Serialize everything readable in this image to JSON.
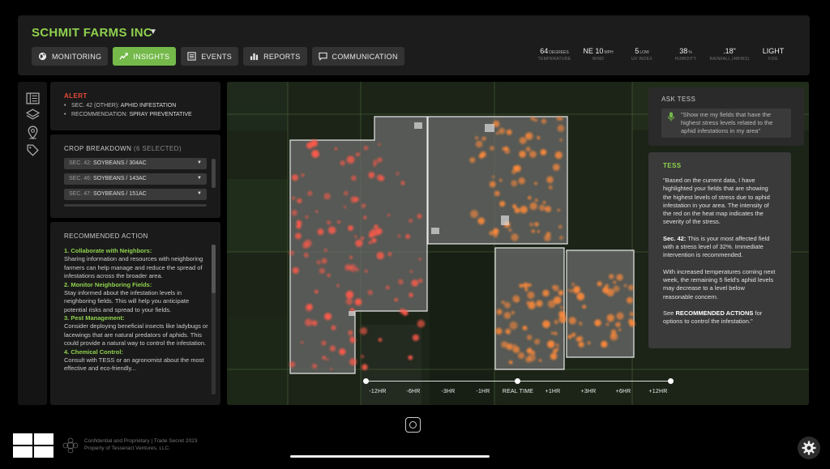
{
  "header": {
    "farm_name": "SCHMIT FARMS INC",
    "tabs": [
      {
        "label": "MONITORING",
        "icon": "globe-icon",
        "active": false
      },
      {
        "label": "INSIGHTS",
        "icon": "trend-icon",
        "active": true
      },
      {
        "label": "EVENTS",
        "icon": "list-icon",
        "active": false
      },
      {
        "label": "REPORTS",
        "icon": "bar-chart-icon",
        "active": false
      },
      {
        "label": "COMMUNICATION",
        "icon": "chat-icon",
        "active": false
      }
    ],
    "weather": [
      {
        "value": "64",
        "unit": "DEGREES",
        "label": "TEMPERATURE"
      },
      {
        "value": "NE 10",
        "unit": "MPH",
        "label": "WIND"
      },
      {
        "value": "5",
        "unit": "LOW",
        "label": "UV INDEX"
      },
      {
        "value": "38",
        "unit": "%",
        "label": "HUMIDITY"
      },
      {
        "value": ".18\"",
        "unit": "",
        "label": "RAINFALL (48HRS)"
      },
      {
        "value": "LIGHT",
        "unit": "",
        "label": "FOG"
      }
    ]
  },
  "alert": {
    "title": "ALERT",
    "line1_label": "SEC. 42 (OTHER): ",
    "line1_value": "APHID INFESTATION",
    "line2_label": "RECOMMENDATION: ",
    "line2_value": "SPRAY PREVENTATIVE"
  },
  "crop_breakdown": {
    "title": "CROP BREAKDOWN",
    "selected": "(6 SELECTED)",
    "rows": [
      {
        "sec": "SEC. 42:",
        "crop": "SOYBEANS / 304AC"
      },
      {
        "sec": "SEC. 46:",
        "crop": "SOYBEANS / 143AC"
      },
      {
        "sec": "SEC. 47:",
        "crop": "SOYBEANS / 151AC"
      }
    ]
  },
  "recommended": {
    "title": "RECOMMENDED ACTION",
    "items": [
      {
        "head": "1. Collaborate with Neighbors:",
        "body": "Sharing information and resources with neighboring farmers can help manage and reduce the spread of infestations across the broader area."
      },
      {
        "head": "2. Monitor Neighboring Fields:",
        "body": "Stay informed about the infestation levels in neighboring fields. This will help you anticipate potential risks and spread to your fields."
      },
      {
        "head": "3. Pest Management:",
        "body": "Consider deploying beneficial insects like ladybugs or lacewings that are natural predators of aphids. This could provide a natural way to control the infestation."
      },
      {
        "head": "4. Chemical Control:",
        "body": "Consult with TESS or an agronomist about the most effective and eco-friendly..."
      }
    ]
  },
  "ask_tess": {
    "title": "ASK TESS",
    "query": "\"Show me my fields that have the highest stress levels related to the aphid infestations in my area\""
  },
  "tess": {
    "title": "TESS",
    "p1": "\"Based on the current data, I have highlighted your fields that are showing the highest levels of stress due to aphid infestation in your area. The intensity of the red on the heat map indicates the severity of the stress.",
    "p2_bold": "Sec. 42:",
    "p2": " This is your most affected field with a stress level of 32%. Immediate intervention is recommended.",
    "p3": "With increased temperatures coming next week, the remaining 5 field's aphid levels may decrease to a level below reasonable concern.",
    "p4_pre": "See ",
    "p4_bold": "RECOMMENDED ACTIONS",
    "p4_post": " for options to control the infestation.\""
  },
  "timeline": {
    "labels": [
      "-12HR",
      "-6HR",
      "-3HR",
      "-1HR",
      "REAL TIME",
      "+1HR",
      "+3HR",
      "+6HR",
      "+12HR"
    ],
    "current": "REAL TIME"
  },
  "footer": {
    "line1": "Confidential and Proprietary | Trade Secret 2023",
    "line2": "Property of Tesseract Ventures, LLC."
  },
  "colors": {
    "accent_green": "#74b94a",
    "alert_red": "#e84a3a",
    "heat_red": "#ff5a4a",
    "heat_orange": "#ff8a3a"
  }
}
